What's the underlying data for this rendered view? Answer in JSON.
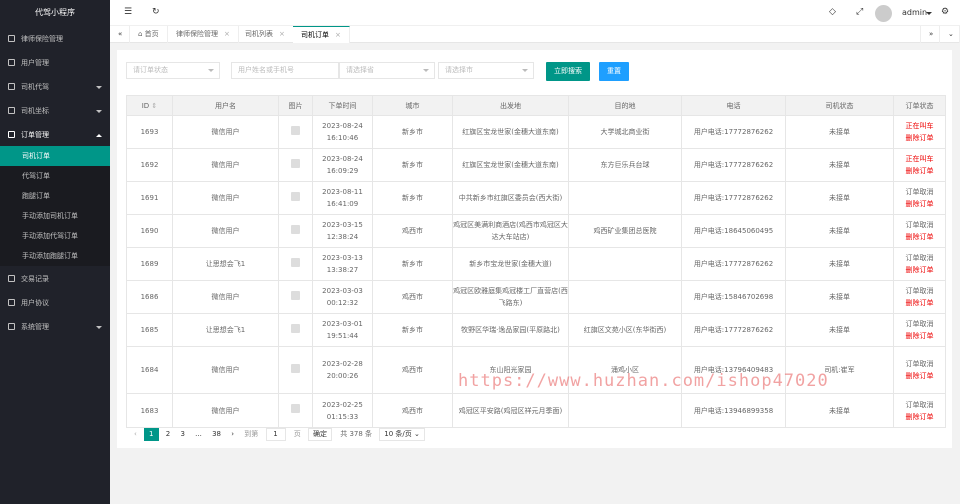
{
  "app_title": "代驾小程序",
  "sidebar": {
    "items": [
      {
        "label": "律师保险管理"
      },
      {
        "label": "用户管理"
      },
      {
        "label": "司机代驾"
      },
      {
        "label": "司机坐标"
      },
      {
        "label": "订单管理"
      },
      {
        "label": "交易记录"
      },
      {
        "label": "用户协议"
      },
      {
        "label": "系统管理"
      }
    ],
    "sub_items": [
      "司机订单",
      "代驾订单",
      "跑腿订单",
      "手动添加司机订单",
      "手动添加代驾订单",
      "手动添加跑腿订单"
    ]
  },
  "topbar": {
    "user": "admin"
  },
  "tabs": [
    "首页",
    "律师保险管理",
    "司机列表",
    "司机订单"
  ],
  "filters": {
    "order_status_placeholder": "请订单状态",
    "name_placeholder": "用户姓名或手机号",
    "province_placeholder": "请选择省",
    "city_placeholder": "请选择市",
    "search_label": "立即搜索",
    "reset_label": "重置"
  },
  "table": {
    "headers": [
      "ID",
      "用户名",
      "图片",
      "下单时间",
      "城市",
      "出发地",
      "目的地",
      "电话",
      "司机状态",
      "订单状态"
    ],
    "rows": [
      {
        "id": "1693",
        "user": "微信用户",
        "date": "2023-08-24",
        "time": "16:10:46",
        "city": "新乡市",
        "from": "红旗区宝龙世家(金穗大道东南)",
        "to": "大学城北商业街",
        "phone": "用户电话:17772876262",
        "driver": "未接单",
        "s1": "正在叫车",
        "s2": "删除订单",
        "s1red": true
      },
      {
        "id": "1692",
        "user": "微信用户",
        "date": "2023-08-24",
        "time": "16:09:29",
        "city": "新乡市",
        "from": "红旗区宝龙世家(金穗大道东南)",
        "to": "东方巨乐兵台球",
        "phone": "用户电话:17772876262",
        "driver": "未接单",
        "s1": "正在叫车",
        "s2": "删除订单",
        "s1red": true
      },
      {
        "id": "1691",
        "user": "微信用户",
        "date": "2023-08-11",
        "time": "16:41:09",
        "city": "新乡市",
        "from": "中共新乡市红旗区委员会(西大街)",
        "to": "",
        "phone": "用户电话:17772876262",
        "driver": "未接单",
        "s1": "订单取消",
        "s2": "删除订单",
        "s1red": false
      },
      {
        "id": "1690",
        "user": "微信用户",
        "date": "2023-03-15",
        "time": "12:38:24",
        "city": "鸡西市",
        "from": "鸡冠区美满利商酒店(鸡西市鸡冠区大达大车站店)",
        "to": "鸡西矿业集团总医院",
        "phone": "用户电话:18645060495",
        "driver": "未接单",
        "s1": "订单取消",
        "s2": "删除订单",
        "s1red": false
      },
      {
        "id": "1689",
        "user": "让思想会飞1",
        "date": "2023-03-13",
        "time": "13:38:27",
        "city": "新乡市",
        "from": "新乡市宝龙世家(金穗大道)",
        "to": "",
        "phone": "用户电话:17772876262",
        "driver": "未接单",
        "s1": "订单取消",
        "s2": "删除订单",
        "s1red": false
      },
      {
        "id": "1686",
        "user": "微信用户",
        "date": "2023-03-03",
        "time": "00:12:32",
        "city": "鸡西市",
        "from": "鸡冠区欧雅庭集鸡冠楼工厂直营店(西飞路东)",
        "to": "",
        "phone": "用户电话:15846702698",
        "driver": "未接单",
        "s1": "订单取消",
        "s2": "删除订单",
        "s1red": false
      },
      {
        "id": "1685",
        "user": "让思想会飞1",
        "date": "2023-03-01",
        "time": "19:51:44",
        "city": "新乡市",
        "from": "牧野区华瑞·逸品家园(平原路北)",
        "to": "红旗区文苑小区(东华街西)",
        "phone": "用户电话:17772876262",
        "driver": "未接单",
        "s1": "订单取消",
        "s2": "删除订单",
        "s1red": false
      },
      {
        "id": "1684",
        "user": "微信用户",
        "date": "2023-02-28",
        "time": "20:00:26",
        "city": "鸡西市",
        "from": "东山阳光家园",
        "to": "涌鸡小区",
        "phone": "用户电话:13796409483",
        "driver": "司机:崔军",
        "s1": "订单取消",
        "s2": "删除订单",
        "s1red": false
      },
      {
        "id": "1683",
        "user": "微信用户",
        "date": "2023-02-25",
        "time": "01:15:33",
        "city": "鸡西市",
        "from": "鸡冠区平安路(鸡冠区祥元月季面)",
        "to": "",
        "phone": "用户电话:13946899358",
        "driver": "未接单",
        "s1": "订单取消",
        "s2": "删除订单",
        "s1red": false
      }
    ]
  },
  "pager": {
    "current": "1",
    "p2": "2",
    "p3": "3",
    "ellipsis": "...",
    "last": "38",
    "goto_label": "到第",
    "page_input": "1",
    "page_unit": "页",
    "confirm": "确定",
    "total": "共 378 条",
    "per_page": "10 条/页"
  },
  "watermark": "https://www.huzhan.com/ishop47020",
  "colors": {
    "sidebar_bg": "#20222a",
    "accent": "#009688",
    "primary": "#1e9fff"
  }
}
